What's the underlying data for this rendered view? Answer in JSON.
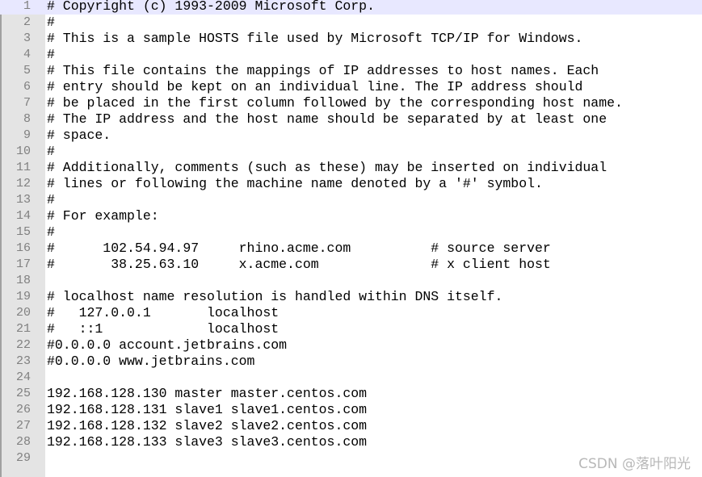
{
  "editor": {
    "current_line": 1,
    "current_line_color": "#e8e8ff",
    "lines": [
      "# Copyright (c) 1993-2009 Microsoft Corp.",
      "#",
      "# This is a sample HOSTS file used by Microsoft TCP/IP for Windows.",
      "#",
      "# This file contains the mappings of IP addresses to host names. Each",
      "# entry should be kept on an individual line. The IP address should",
      "# be placed in the first column followed by the corresponding host name.",
      "# The IP address and the host name should be separated by at least one",
      "# space.",
      "#",
      "# Additionally, comments (such as these) may be inserted on individual",
      "# lines or following the machine name denoted by a '#' symbol.",
      "#",
      "# For example:",
      "#",
      "#      102.54.94.97     rhino.acme.com          # source server",
      "#       38.25.63.10     x.acme.com              # x client host",
      "",
      "# localhost name resolution is handled within DNS itself.",
      "#   127.0.0.1       localhost",
      "#   ::1             localhost",
      "#0.0.0.0 account.jetbrains.com",
      "#0.0.0.0 www.jetbrains.com",
      "",
      "192.168.128.130 master master.centos.com",
      "192.168.128.131 slave1 slave1.centos.com",
      "192.168.128.132 slave2 slave2.centos.com",
      "192.168.128.133 slave3 slave3.centos.com",
      ""
    ]
  },
  "watermark": "CSDN @落叶阳光"
}
